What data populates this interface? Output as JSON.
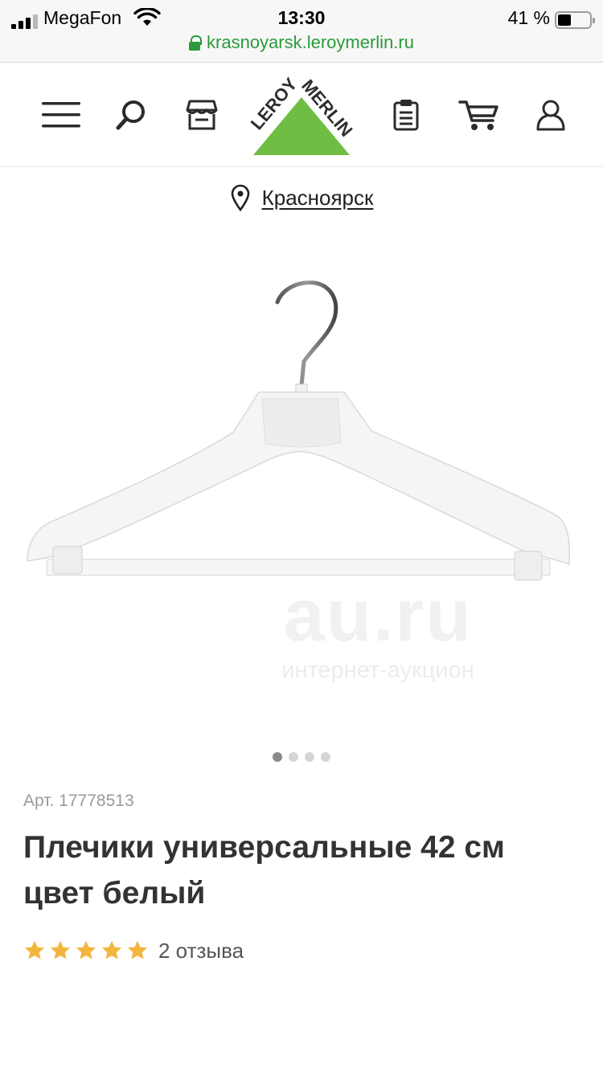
{
  "status_bar": {
    "carrier": "MegaFon",
    "time": "13:30",
    "battery": "41 %",
    "battery_level": 0.41
  },
  "browser": {
    "url": "krasnoyarsk.leroymerlin.ru"
  },
  "header": {
    "logo_text_left": "LEROY",
    "logo_text_right": "MERLIN",
    "brand_colors": {
      "green": "#6ebe44",
      "dark": "#3a3a3a"
    },
    "icons": [
      "menu-icon",
      "search-icon",
      "store-icon",
      "clipboard-icon",
      "cart-icon",
      "user-icon"
    ]
  },
  "location": {
    "city": "Красноярск"
  },
  "gallery": {
    "watermark_big": "au.ru",
    "watermark_small": "интернет-аукцион",
    "image_count": 4,
    "active_index": 0
  },
  "product": {
    "article": "Арт. 17778513",
    "title": "Плечики универсальные 42 см цвет белый",
    "rating": 5,
    "reviews": "2 отзыва",
    "star_color": "#f2b63f"
  }
}
